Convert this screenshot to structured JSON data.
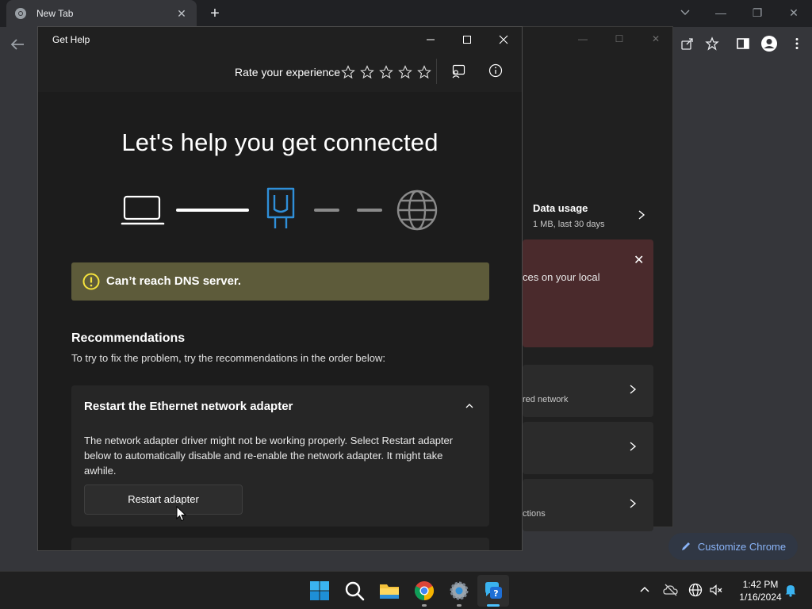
{
  "browser": {
    "tab_title": "New Tab",
    "customize_label": "Customize Chrome"
  },
  "settings_bg": {
    "data_usage_title": "Data usage",
    "data_usage_sub": "1 MB, last 30 days",
    "alert_partial": "ces on your local",
    "card1_partial": "red network",
    "card3_partial": "ctions"
  },
  "gethelp": {
    "window_title": "Get Help",
    "rate_label": "Rate your experience",
    "stars": 5,
    "headline": "Let's help you get connected",
    "dns_message": "Can’t reach DNS server.",
    "recommendations_title": "Recommendations",
    "recommendations_sub": "To try to fix the problem, try the recommendations in the order below:",
    "card_title": "Restart the Ethernet network adapter",
    "card_body": "The network adapter driver might not be working properly. Select Restart adapter below to automatically disable and re-enable the network adapter. It might take awhile.",
    "restart_button": "Restart adapter"
  },
  "taskbar": {
    "time": "1:42 PM",
    "date": "1/16/2024"
  },
  "colors": {
    "accent": "#4cc2ff",
    "warning_banner": "#5d5b3a",
    "warning_icon": "#f5e33d",
    "adapter_blue": "#2f8fd8"
  }
}
